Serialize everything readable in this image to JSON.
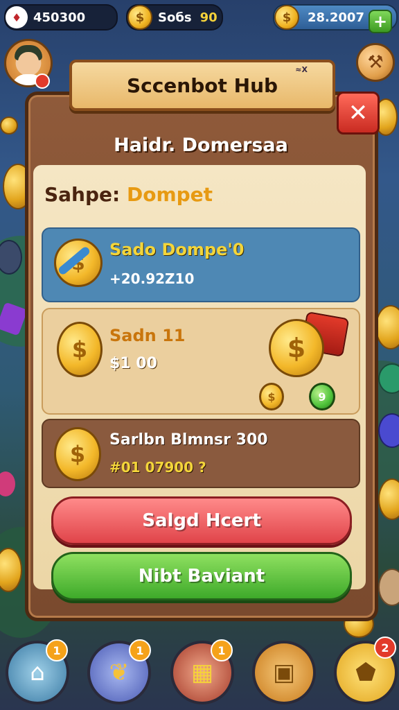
{
  "topbar": {
    "gems": "450300",
    "coins_label": "Soбs",
    "coins_value": "90",
    "balance": "28.2007",
    "plus": "+"
  },
  "header": {
    "title": "Sccenbot Hub",
    "tag": "≈X"
  },
  "panel": {
    "close": "✕",
    "heading": "Haidr. Domersaa",
    "subtitle_a": "Sahpe:",
    "subtitle_b": "Dompet"
  },
  "cards": [
    {
      "title": "Sado Dompe'0",
      "value": "+20.92Z10"
    },
    {
      "title": "Sadn 11",
      "value": "$1 00",
      "mini": "9"
    },
    {
      "title": "Sarlbn Blmnsr 300",
      "value": "#01 07900 ?"
    }
  ],
  "buttons": {
    "red": "Salgd Hcert",
    "green": "Nibt Baviant"
  },
  "nav": {
    "badges": [
      "1",
      "1",
      "1",
      "2"
    ]
  },
  "colors": {
    "accent": "#e79a12",
    "red_button": "#e0444a",
    "green_button": "#3eaa2a",
    "panel": "#7a4a2e"
  }
}
